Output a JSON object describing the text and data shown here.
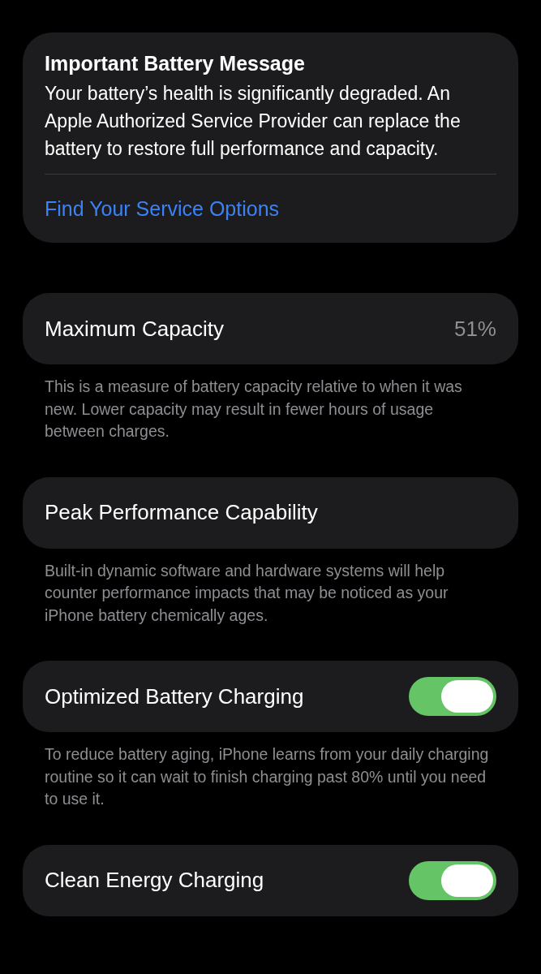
{
  "message_card": {
    "title": "Important Battery Message",
    "body": "Your battery’s health is significantly degraded. An Apple Authorized Service Provider can replace the battery to restore full performance and capacity.",
    "link": "Find Your Service Options"
  },
  "sections": [
    {
      "kind": "value",
      "label": "Maximum Capacity",
      "value": "51%",
      "footer": "This is a measure of battery capacity relative to when it was new. Lower capacity may result in fewer hours of usage between charges."
    },
    {
      "kind": "plain",
      "label": "Peak Performance Capability",
      "footer": "Built-in dynamic software and hardware systems will help counter performance impacts that may be noticed as your iPhone battery chemically ages."
    },
    {
      "kind": "toggle",
      "label": "Optimized Battery Charging",
      "on": true,
      "footer": "To reduce battery aging, iPhone learns from your daily charging routine so it can wait to finish charging past 80% until you need to use it."
    },
    {
      "kind": "toggle",
      "label": "Clean Energy Charging",
      "on": true
    }
  ]
}
